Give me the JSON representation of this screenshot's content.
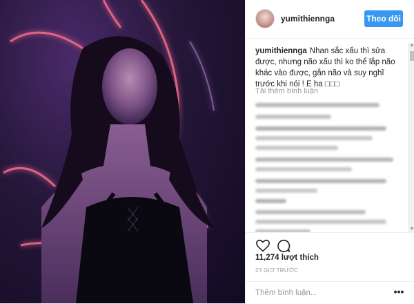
{
  "post": {
    "username": "yumithiennga",
    "follow_label": "Theo dõi",
    "caption_user": "yumithiennga",
    "caption_text": "Nhan sắc xấu thì sửa được, nhưng não xấu thì ko thể lắp não khác vào được, gắn não và suy nghĩ trước khi nói ! E ha □□□",
    "load_more_label": "Tải thêm bình luận",
    "likes_label": "11,274 lượt thích",
    "time_label": "23 GIỜ TRƯỚC",
    "comment_placeholder": "Thêm bình luận...",
    "more_label": "•••"
  },
  "icons": {
    "like": "heart-icon",
    "comment": "comment-bubble-icon",
    "more": "more-options-icon"
  },
  "colors": {
    "follow_button": "#3897f0",
    "neon": "#ff5a7a"
  }
}
